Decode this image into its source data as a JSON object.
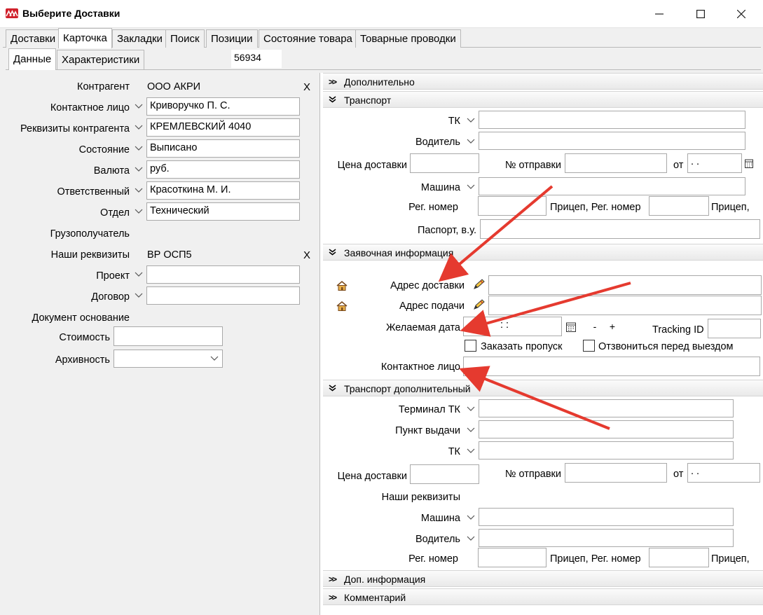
{
  "window": {
    "title": "Выберите Доставки"
  },
  "tabs": [
    "Доставки",
    "Карточка",
    "Закладки",
    "Поиск",
    "Позиции",
    "Состояние товара",
    "Товарные проводки"
  ],
  "subtabs": [
    "Данные",
    "Характеристики"
  ],
  "doc_number": "56934",
  "left": {
    "kontragent_label": "Контрагент",
    "kontragent_value": "ООО АКРИ",
    "clear_mark": "X",
    "contact_label": "Контактное лицо",
    "contact_value": "Криворучко П. С.",
    "requisites_label": "Реквизиты контрагента",
    "requisites_value": "КРЕМЛЕВСКИЙ 4040",
    "state_label": "Состояние",
    "state_value": "Выписано",
    "currency_label": "Валюта",
    "currency_value": "руб.",
    "responsible_label": "Ответственный",
    "responsible_value": "Красоткина М. И.",
    "dept_label": "Отдел",
    "dept_value": "Технический",
    "consignee_label": "Грузополучатель",
    "our_req_label": "Наши реквизиты",
    "our_req_value": "ВР ОСП5",
    "project_label": "Проект",
    "project_value": "",
    "contract_label": "Договор",
    "contract_value": "",
    "base_doc_label": "Документ основание",
    "cost_label": "Стоимость",
    "cost_value": "",
    "archive_label": "Архивность",
    "archive_value": ""
  },
  "sections": {
    "extra": "Дополнительно",
    "transport": "Транспорт",
    "request": "Заявочная информация",
    "transport_extra": "Транспорт дополнительный",
    "add_info": "Доп. информация",
    "comment": "Комментарий"
  },
  "transport": {
    "tk_label": "ТК",
    "driver_label": "Водитель",
    "price_label": "Цена доставки",
    "shipment_no_label": "№ отправки",
    "from_label": "от",
    "date_value": " .  .",
    "car_label": "Машина",
    "reg_label": "Рег. номер",
    "trailer_reg_label": "Прицеп, Рег. номер",
    "trailer_label": "Прицеп,",
    "passport_label": "Паспорт, в.у."
  },
  "request": {
    "delivery_addr_label": "Адрес доставки",
    "pickup_addr_label": "Адрес подачи",
    "desired_date_label": "Желаемая дата",
    "time_value": ":  :",
    "minus": "-",
    "plus": "+",
    "tracking_label": "Tracking ID",
    "order_pass_label": "Заказать пропуск",
    "call_before_label": "Отзвониться перед выездом",
    "contact_label": "Контактное лицо"
  },
  "transport_extra": {
    "terminal_label": "Терминал ТК",
    "pickup_point_label": "Пункт выдачи",
    "tk_label": "ТК",
    "price_label": "Цена доставки",
    "shipment_no_label": "№ отправки",
    "from_label": "от",
    "date_value": " .  .",
    "our_req_label": "Наши реквизиты",
    "car_label": "Машина",
    "driver_label": "Водитель",
    "reg_label": "Рег. номер",
    "trailer_reg_label": "Прицеп, Рег. номер",
    "trailer_label": "Прицеп,"
  },
  "colors": {
    "arrow": "#e53a2f",
    "logo": "#d0202b"
  }
}
